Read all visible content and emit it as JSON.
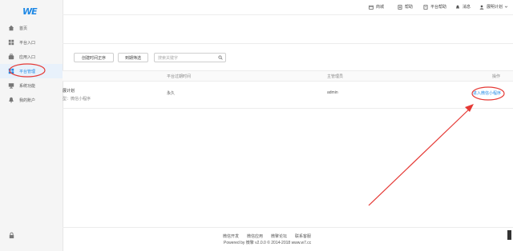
{
  "logo": {
    "text": "WE"
  },
  "sidebar": {
    "items": [
      {
        "label": "首页",
        "icon": "home-icon"
      },
      {
        "label": "平台入口",
        "icon": "grid-icon"
      },
      {
        "label": "应用入口",
        "icon": "briefcase-icon"
      },
      {
        "label": "平台管理",
        "icon": "apps-icon",
        "active": true
      },
      {
        "label": "系统功能",
        "icon": "monitor-icon"
      },
      {
        "label": "我的账户",
        "icon": "bell-icon"
      }
    ]
  },
  "topbar": {
    "store": "商城",
    "help": "帮助",
    "site_help": "平台帮助",
    "messages": "消息",
    "user": "展明计划"
  },
  "filters": {
    "sort": "创建时间正序",
    "expiry": "到期筛选",
    "search_placeholder": "搜索关键字"
  },
  "table": {
    "headers": {
      "expiry": "平台过期时间",
      "manager": "主管理员",
      "actions": "操作"
    },
    "rows": [
      {
        "name": "展计划",
        "type": "型：微信小程序",
        "expiry": "永久",
        "manager": "admin",
        "action": "进入微信小程序"
      }
    ]
  },
  "footer": {
    "links": [
      "微信开发",
      "微信应用",
      "微擎论坛",
      "联系客服"
    ],
    "copyright": "Powered by 微擎 v2.0.0 © 2014-2018 www.w7.cc"
  },
  "colors": {
    "accent": "#1e88e5",
    "annotation": "#e53935"
  }
}
